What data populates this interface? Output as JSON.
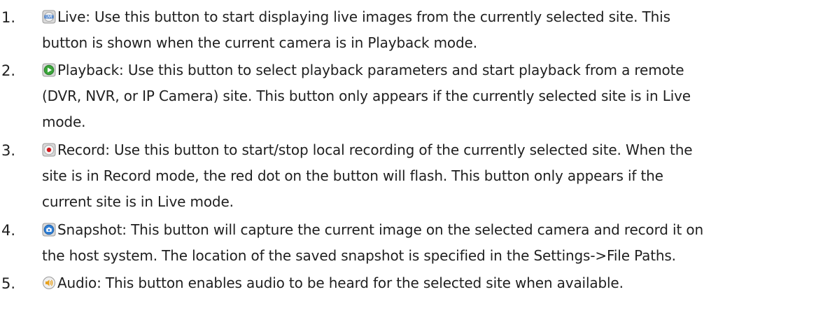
{
  "items": [
    {
      "number": "1.",
      "icon": "live-icon",
      "lines": [
        "Live: Use this button to start displaying live images from the currently selected site. This",
        "button is shown when the current camera is in Playback mode."
      ]
    },
    {
      "number": "2.",
      "icon": "playback-icon",
      "lines": [
        "Playback: Use this button to select playback parameters and start playback from a remote",
        "(DVR, NVR, or IP Camera) site. This button only appears if the currently selected site is in Live",
        "mode."
      ]
    },
    {
      "number": "3.",
      "icon": "record-icon",
      "lines": [
        "Record: Use this button to start/stop local recording of the currently selected site. When the",
        "site is in Record mode, the red dot on the button will flash. This button only appears if the",
        "current site is in Live mode."
      ]
    },
    {
      "number": "4.",
      "icon": "snapshot-icon",
      "lines": [
        "Snapshot: This button will capture the current image on the selected camera and record it on",
        "the host system. The location of the saved snapshot is specified in the Settings->File Paths."
      ]
    },
    {
      "number": "5.",
      "icon": "audio-icon",
      "lines": [
        "Audio:  This button enables audio to be heard for the selected site when available."
      ]
    }
  ],
  "colors": {
    "text": "#1f1f1f",
    "record_dot": "#d0161b",
    "playback_green": "#3aa53a",
    "snapshot_blue": "#2f7fd6",
    "audio_orange": "#e8a21f"
  }
}
